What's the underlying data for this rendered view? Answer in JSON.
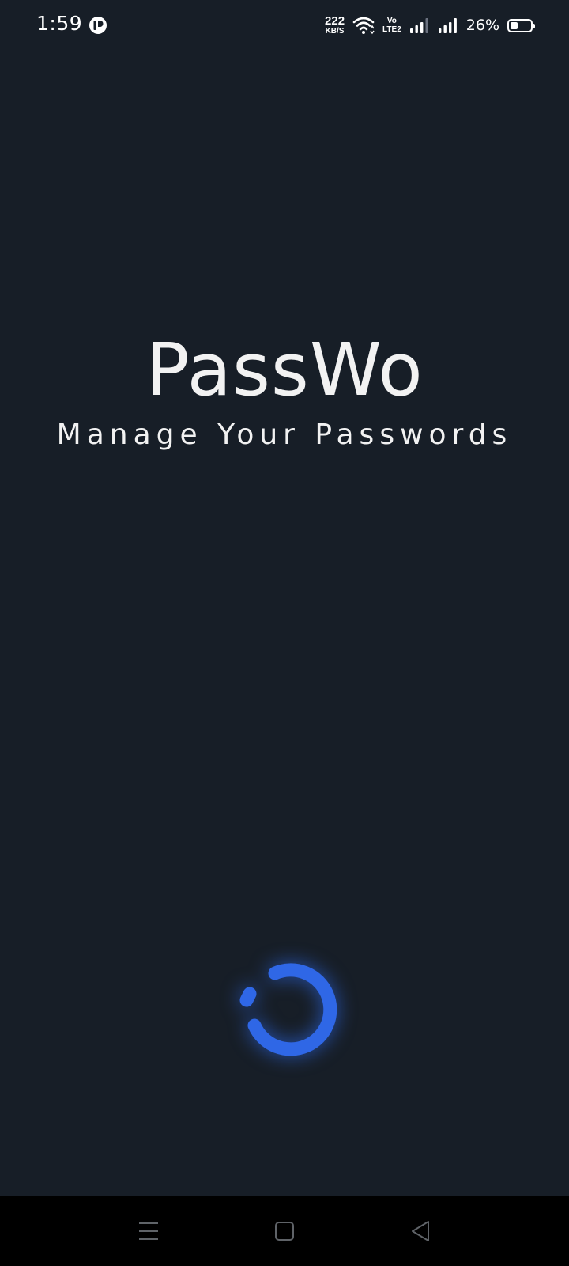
{
  "status_bar": {
    "time": "1:59",
    "app_icon": "app-notification-icon",
    "net_speed_value": "222",
    "net_speed_unit": "KB/S",
    "wifi_icon": "wifi-icon",
    "volte_top": "Vo",
    "volte_bottom": "LTE2",
    "signal_icons": [
      "signal-sim1-icon",
      "signal-sim2-icon"
    ],
    "battery_percent": "26%",
    "battery_level": 0.26
  },
  "splash": {
    "title": "PassWo",
    "subtitle": "Manage Your Passwords",
    "accent_color": "#2f67e6",
    "background_color": "#171e27",
    "spinner_icon": "loading-spinner-icon"
  },
  "nav_bar": {
    "buttons": [
      "menu-icon",
      "home-icon",
      "back-icon"
    ]
  }
}
